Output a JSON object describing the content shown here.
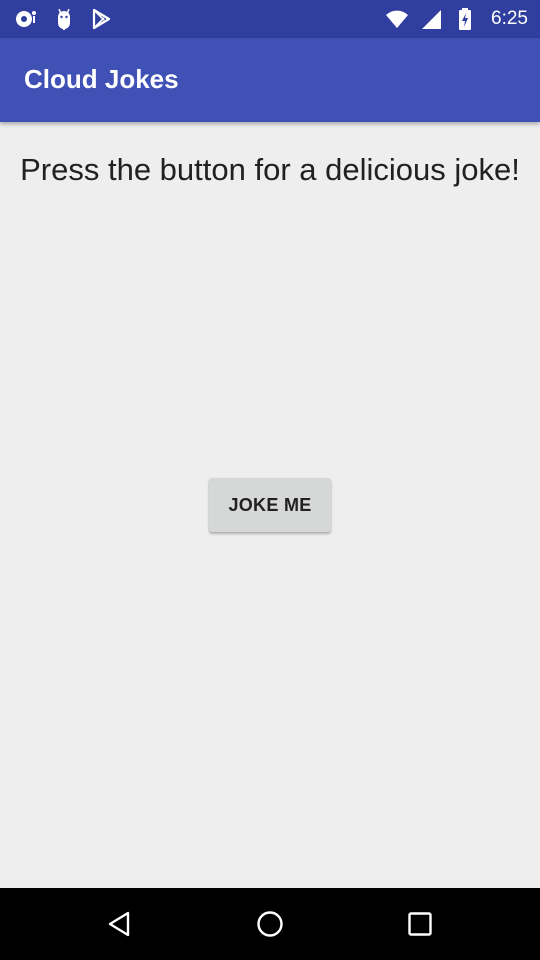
{
  "status_bar": {
    "time": "6:25",
    "left_icons": [
      "notification-dot-icon",
      "android-icon",
      "play-store-icon"
    ],
    "right_icons": [
      "wifi-icon",
      "signal-icon",
      "battery-icon"
    ]
  },
  "app_bar": {
    "title": "Cloud Jokes"
  },
  "main": {
    "instructions": "Press the button for a delicious joke!",
    "button_label": "JOKE ME"
  },
  "nav_bar": {
    "icons": [
      "back-icon",
      "home-icon",
      "recent-apps-icon"
    ]
  },
  "colors": {
    "status_bar": "#303f9f",
    "app_bar": "#3f51b5",
    "background": "#eeeeee",
    "button": "#d6d7d7"
  }
}
